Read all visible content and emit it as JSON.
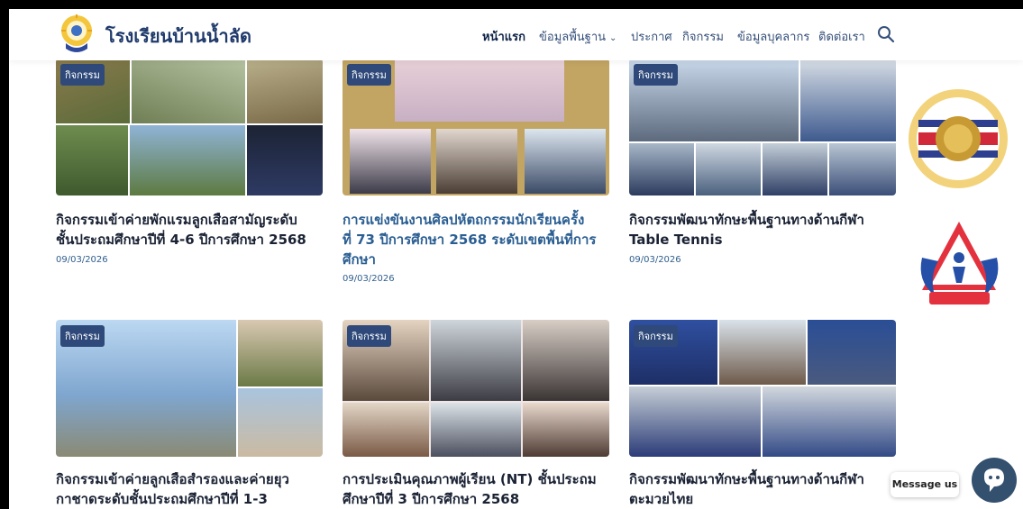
{
  "header": {
    "site_title": "โรงเรียนบ้านน้ำลัด",
    "nav": [
      {
        "label": "หน้าแรก",
        "active": true
      },
      {
        "label": "ข้อมูลพื้นฐาน",
        "has_dropdown": true
      },
      {
        "label": "ประกาศ"
      },
      {
        "label": "กิจกรรม"
      },
      {
        "label": "ข้อมูลบุคลากร"
      },
      {
        "label": "ติดต่อเรา"
      }
    ],
    "search_icon": "search-icon"
  },
  "posts": [
    {
      "category": "กิจกรรม",
      "title_lines": [
        "กิจกรรมเข้าค่ายพักแรมลูกเสือสามัญระดับ",
        "ชั้นประถมศึกษาปีที่ 4-6 ปีการศึกษา 2568"
      ],
      "date": "09/03/2026"
    },
    {
      "category": "กิจกรรม",
      "title_lines": [
        "การแข่งขันงานศิลปหัตถกรรมนักเรียนครั้ง",
        "ที่ 73 ปีการศึกษา 2568 ระดับเขตพื้นที่การ",
        "ศึกษา"
      ],
      "date": "09/03/2026"
    },
    {
      "category": "กิจกรรม",
      "title_lines": [
        "กิจกรรมพัฒนาทักษะพื้นฐานทางด้านกีฬา",
        "Table Tennis"
      ],
      "date": "09/03/2026"
    },
    {
      "category": "กิจกรรม",
      "title_lines": [
        "กิจกรรมเข้าค่ายลูกเสือสำรองและค่ายยุว",
        "กาชาดระดับชั้นประถมศึกษาปีที่ 1-3"
      ],
      "date": ""
    },
    {
      "category": "กิจกรรม",
      "title_lines": [
        "การประเมินคุณภาพผู้เรียน (NT) ชั้นประถม",
        "ศึกษาปีที่ 3 ปีการศึกษา 2568"
      ],
      "date": ""
    },
    {
      "category": "กิจกรรม",
      "title_lines": [
        "กิจกรรมพัฒนาทักษะพื้นฐานทางด้านกีฬา",
        "ตะมวยไทย"
      ],
      "date": ""
    }
  ],
  "side_banners": [
    {
      "label": "โครงการสถานศึกษาสีขาว ปลอดยาเสพติดและอบายมุข"
    },
    {
      "label": "พลังแผ่นดิน เอาชนะยาเสพติด"
    }
  ],
  "messenger": {
    "label": "Message us"
  },
  "colors": {
    "brand": "#1f3a6b",
    "link": "#2a5e92",
    "badge": "#2f4a7a"
  }
}
